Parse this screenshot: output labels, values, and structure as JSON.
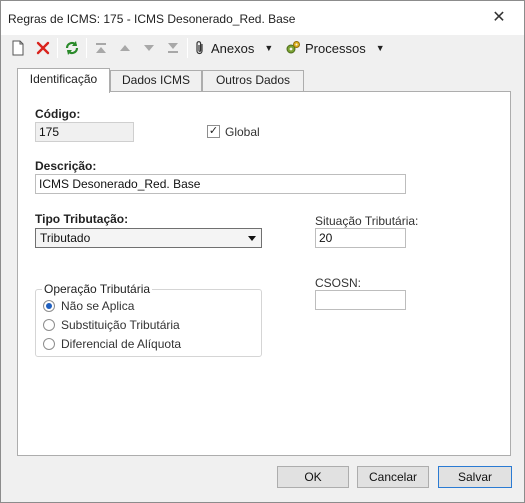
{
  "window": {
    "title": "Regras de ICMS: 175 - ICMS Desonerado_Red. Base",
    "close_glyph": "✕"
  },
  "toolbar": {
    "new_icon": "new-document-icon",
    "delete_icon": "delete-icon",
    "refresh_icon": "refresh-icon",
    "first_icon": "first-record-icon",
    "prev_icon": "previous-record-icon",
    "next_icon": "next-record-icon",
    "last_icon": "last-record-icon",
    "anexos_label": "Anexos",
    "processos_label": "Processos"
  },
  "tabs": [
    {
      "label": "Identificação",
      "active": true
    },
    {
      "label": "Dados ICMS",
      "active": false
    },
    {
      "label": "Outros Dados",
      "active": false
    }
  ],
  "form": {
    "codigo_label": "Código:",
    "codigo_value": "175",
    "global_label": "Global",
    "global_checked": true,
    "descricao_label": "Descrição:",
    "descricao_value": "ICMS Desonerado_Red. Base",
    "tipo_tributacao_label": "Tipo Tributação:",
    "tipo_tributacao_value": "Tributado",
    "situacao_label": "Situação Tributária:",
    "situacao_value": "20",
    "csosn_label": "CSOSN:",
    "csosn_value": "",
    "operacao_group_label": "Operação Tributária",
    "operacao_options": [
      {
        "label": "Não se Aplica",
        "selected": true
      },
      {
        "label": "Substituição Tributária",
        "selected": false
      },
      {
        "label": "Diferencial de Alíquota",
        "selected": false
      }
    ]
  },
  "footer": {
    "ok_label": "OK",
    "cancel_label": "Cancelar",
    "save_label": "Salvar"
  },
  "colors": {
    "accent_blue": "#2b7bd3",
    "delete_red": "#d9231d",
    "refresh_green": "#2a8a2a"
  }
}
